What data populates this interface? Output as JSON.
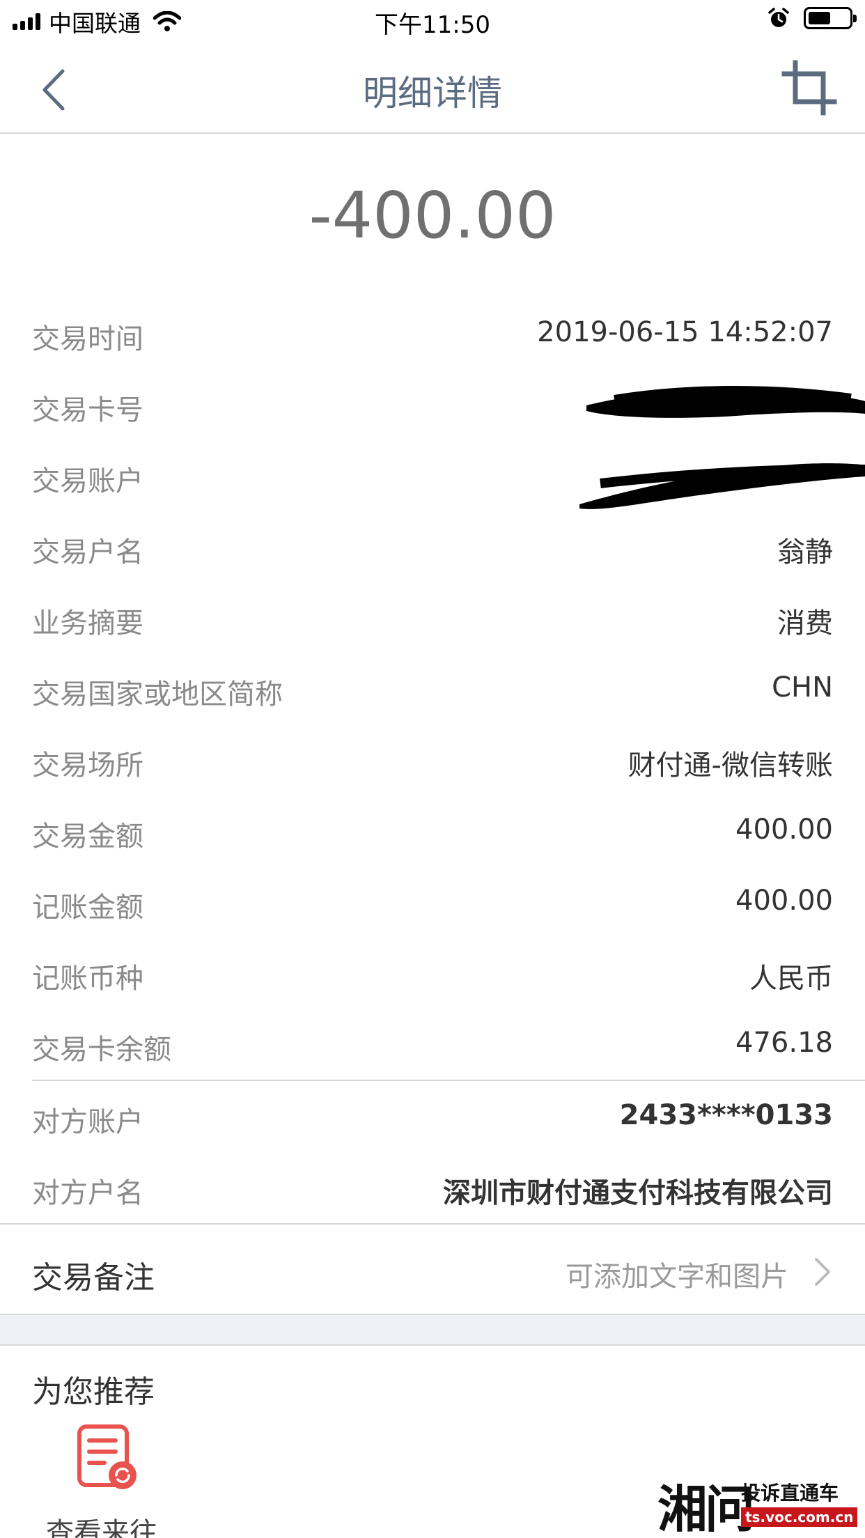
{
  "status_bar": {
    "carrier": "中国联通",
    "time": "下午11:50",
    "battery_level": 0.55
  },
  "nav": {
    "title": "明细详情",
    "back_icon": "chevron-left-icon",
    "crop_icon": "crop-icon"
  },
  "amount": "-400.00",
  "details": [
    {
      "label": "交易时间",
      "value": "2019-06-15 14:52:07"
    },
    {
      "label": "交易卡号",
      "value": ""
    },
    {
      "label": "交易账户",
      "value": ""
    },
    {
      "label": "交易户名",
      "value": "翁静"
    },
    {
      "label": "业务摘要",
      "value": "消费"
    },
    {
      "label": "交易国家或地区简称",
      "value": "CHN"
    },
    {
      "label": "交易场所",
      "value": "财付通-微信转账"
    },
    {
      "label": "交易金额",
      "value": "400.00"
    },
    {
      "label": "记账金额",
      "value": "400.00"
    },
    {
      "label": "记账币种",
      "value": "人民币"
    },
    {
      "label": "交易卡余额",
      "value": "476.18"
    }
  ],
  "counterparty": [
    {
      "label": "对方账户",
      "value": "2433****0133"
    },
    {
      "label": "对方户名",
      "value": "深圳市财付通支付科技有限公司"
    }
  ],
  "remark": {
    "label": "交易备注",
    "hint": "可添加文字和图片"
  },
  "recommend": {
    "title": "为您推荐",
    "items": [
      {
        "label": "查看来往",
        "icon": "document-refresh-icon"
      }
    ]
  },
  "watermark": {
    "logo_text": "湘问",
    "tagline": "投诉直通车",
    "url": "ts.voc.com.cn"
  },
  "colors": {
    "nav_title": "#5b6b80",
    "label": "#8a8a8a",
    "accent_red": "#e8524f"
  }
}
